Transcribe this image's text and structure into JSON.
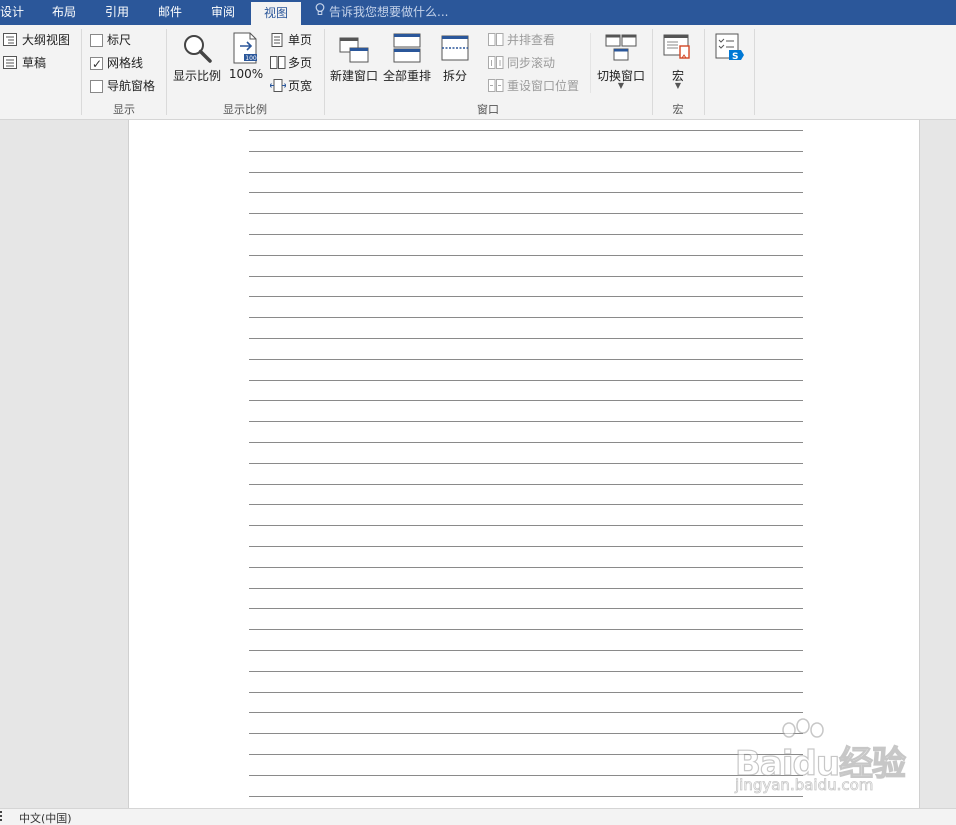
{
  "tabs": [
    {
      "label": "设计"
    },
    {
      "label": "布局"
    },
    {
      "label": "引用"
    },
    {
      "label": "邮件"
    },
    {
      "label": "审阅"
    },
    {
      "label": "视图"
    }
  ],
  "tell_me": {
    "placeholder": "告诉我您想要做什么..."
  },
  "ribbon": {
    "views": {
      "outline": "大纲视图",
      "draft": "草稿"
    },
    "show": {
      "group_label": "显示",
      "ruler": {
        "label": "标尺",
        "checked": false
      },
      "gridlines": {
        "label": "网格线",
        "checked": true
      },
      "nav_pane": {
        "label": "导航窗格",
        "checked": false
      }
    },
    "zoom": {
      "group_label": "显示比例",
      "zoom_button": "显示比例",
      "hundred_button": "100%",
      "one_page": "单页",
      "multi_page": "多页",
      "page_width": "页宽"
    },
    "window": {
      "group_label": "窗口",
      "new_window": "新建窗口",
      "arrange_all": "全部重排",
      "split": "拆分",
      "side_by_side": "并排查看",
      "sync_scroll": "同步滚动",
      "reset_position": "重设窗口位置",
      "switch_windows": "切换窗口"
    },
    "macros": {
      "group_label": "宏",
      "macros_button": "宏"
    }
  },
  "watermark": {
    "brand": "Baidu经验",
    "url": "jingyan.baidu.com"
  },
  "status_bar": {
    "language": "中文(中国)"
  },
  "colors": {
    "accent": "#2b579a",
    "ribbon_bg": "#f3f3f3",
    "workspace_bg": "#e6e6e6",
    "sharepoint": "#0078d4"
  }
}
